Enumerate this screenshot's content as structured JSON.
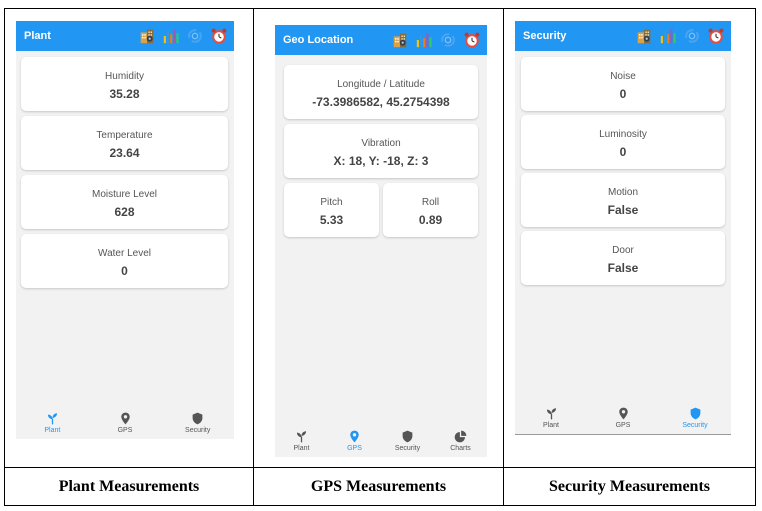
{
  "colors": {
    "accent": "#2196f3",
    "nav_inactive": "#555555"
  },
  "screens": [
    {
      "title": "Plant",
      "cards": [
        {
          "label": "Humidity",
          "value": "35.28"
        },
        {
          "label": "Temperature",
          "value": "23.64"
        },
        {
          "label": "Moisture Level",
          "value": "628"
        },
        {
          "label": "Water Level",
          "value": "0"
        }
      ],
      "nav": [
        {
          "label": "Plant",
          "icon": "sprout-icon",
          "active": true
        },
        {
          "label": "GPS",
          "icon": "location-pin-icon",
          "active": false
        },
        {
          "label": "Security",
          "icon": "shield-icon",
          "active": false
        }
      ],
      "caption": "Plant Measurements"
    },
    {
      "title": "Geo Location",
      "cards": [
        {
          "label": "Longitude / Latitude",
          "value": "-73.3986582, 45.2754398"
        },
        {
          "label": "Vibration",
          "value": "X: 18, Y: -18, Z: 3"
        },
        {
          "label": "Pitch",
          "value": "5.33"
        },
        {
          "label": "Roll",
          "value": "0.89"
        }
      ],
      "nav": [
        {
          "label": "Plant",
          "icon": "sprout-icon",
          "active": false
        },
        {
          "label": "GPS",
          "icon": "location-pin-icon",
          "active": true
        },
        {
          "label": "Security",
          "icon": "shield-icon",
          "active": false
        },
        {
          "label": "Charts",
          "icon": "pie-chart-icon",
          "active": false
        }
      ],
      "caption": "GPS Measurements"
    },
    {
      "title": "Security",
      "cards": [
        {
          "label": "Noise",
          "value": "0"
        },
        {
          "label": "Luminosity",
          "value": "0"
        },
        {
          "label": "Motion",
          "value": "False"
        },
        {
          "label": "Door",
          "value": "False"
        }
      ],
      "nav": [
        {
          "label": "Plant",
          "icon": "sprout-icon",
          "active": false
        },
        {
          "label": "GPS",
          "icon": "location-pin-icon",
          "active": false
        },
        {
          "label": "Security",
          "icon": "shield-icon",
          "active": true
        }
      ],
      "caption": "Security Measurements"
    }
  ],
  "header_icons": [
    "building-icon",
    "bar-chart-icon",
    "refresh-icon",
    "alarm-clock-icon"
  ]
}
